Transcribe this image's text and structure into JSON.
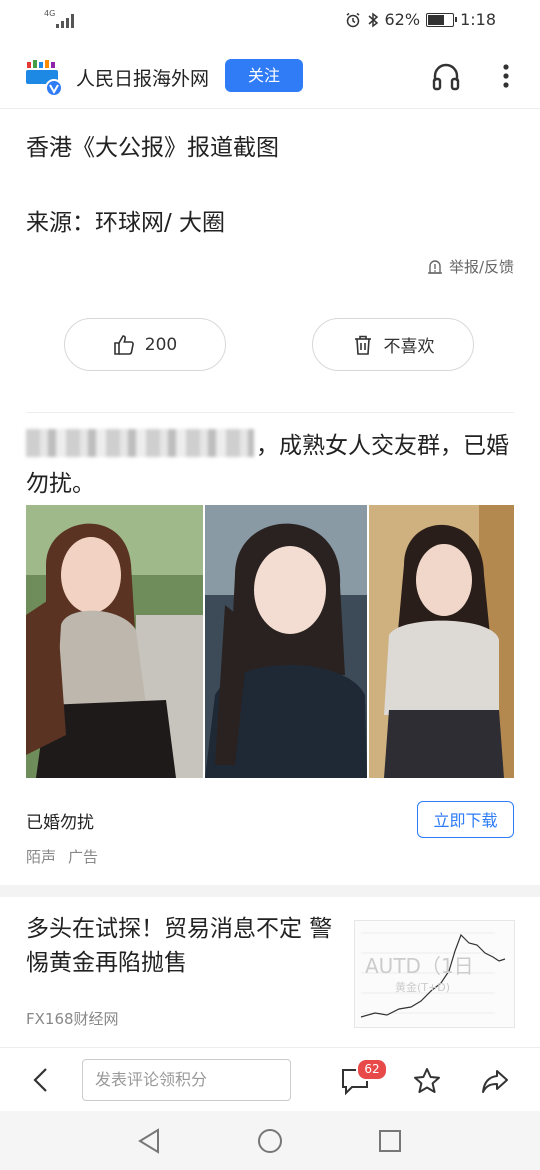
{
  "status": {
    "network": "4G",
    "battery": "62%",
    "battery_level": 0.62,
    "time": "1:18"
  },
  "header": {
    "site_name": "人民日报海外网",
    "follow_label": "关注"
  },
  "article": {
    "line1": "香港《大公报》报道截图",
    "line2": "来源：环球网/ 大圈",
    "report_label": "举报/反馈",
    "like_count": "200",
    "dislike_label": "不喜欢"
  },
  "ad": {
    "title_visible": "，成熟女人交友群，已婚勿扰。",
    "name": "已婚勿扰",
    "source": "陌声",
    "tag": "广告",
    "download_label": "立即下载"
  },
  "news": {
    "title": "多头在试探！贸易消息不定 警惕黄金再陷抛售",
    "source": "FX168财经网",
    "thumb_text": "AUTD（1日",
    "thumb_subtext": "黄金(T+D)"
  },
  "bottom_bar": {
    "comment_placeholder": "发表评论领积分",
    "comment_badge": "62"
  },
  "colors": {
    "accent": "#2f7cf6",
    "badge": "#e84a4a"
  }
}
